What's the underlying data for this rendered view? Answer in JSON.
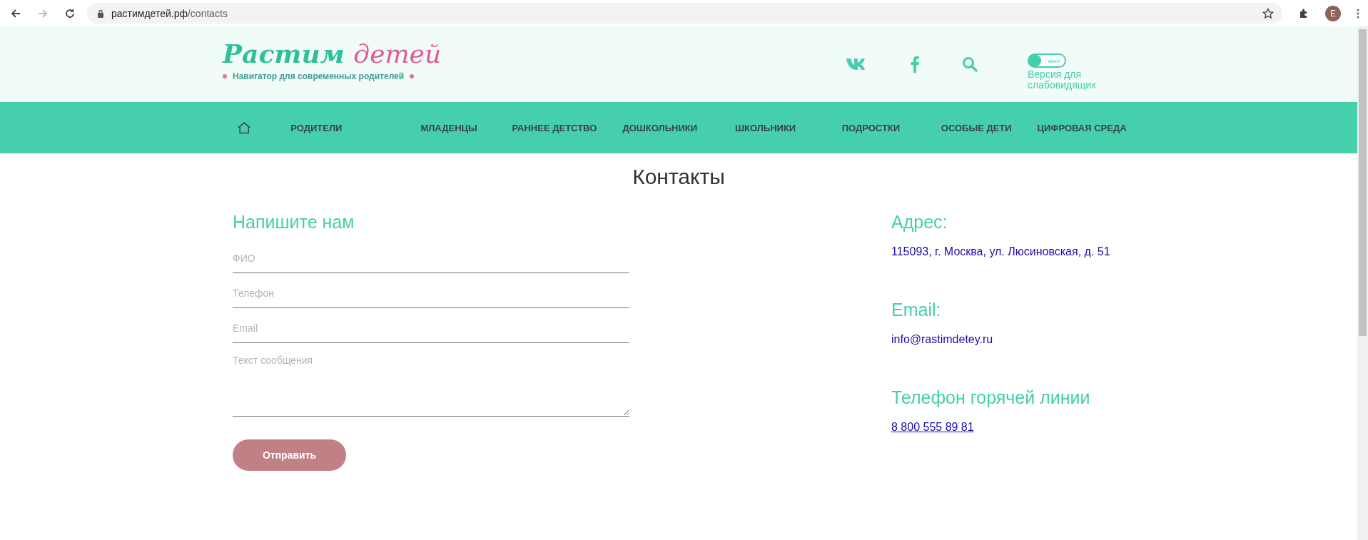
{
  "browser": {
    "back_disabled": false,
    "forward_disabled": true,
    "url_host": "растимдетей.рф",
    "url_path": "/contacts",
    "avatar": "E"
  },
  "logo": {
    "word_1": "Растим",
    "word_2": "детей",
    "tagline": "Навигатор для современных родителей"
  },
  "accessibility": {
    "toggle_label": "выкл",
    "on": false,
    "caption": "Версия для слабовидящих"
  },
  "nav": [
    {
      "label": "РОДИТЕЛИ"
    },
    {
      "label": "МЛАДЕНЦЫ"
    },
    {
      "label": "РАННЕЕ ДЕТСТВО"
    },
    {
      "label": "ДОШКОЛЬНИКИ"
    },
    {
      "label": "ШКОЛЬНИКИ"
    },
    {
      "label": "ПОДРОСТКИ"
    },
    {
      "label": "ОСОБЫЕ ДЕТИ"
    },
    {
      "label": "ЦИФРОВАЯ СРЕДА"
    }
  ],
  "page_title": "Контакты",
  "form": {
    "heading": "Напишите нам",
    "fields": [
      {
        "kind": "input",
        "placeholder": "ФИО"
      },
      {
        "kind": "input",
        "placeholder": "Телефон"
      },
      {
        "kind": "input",
        "placeholder": "Email"
      },
      {
        "kind": "textarea",
        "placeholder": "Текст сообщения"
      }
    ],
    "submit": "Отправить"
  },
  "contacts": [
    {
      "heading": "Адрес:",
      "value": "115093, г. Москва, ул. Люсиновская, д. 51",
      "kind": "text"
    },
    {
      "heading": "Email:",
      "value": "info@rastimdetey.ru",
      "kind": "text"
    },
    {
      "heading": "Телефон горячей линии",
      "value": "8 800 555 89 81",
      "kind": "link"
    }
  ]
}
